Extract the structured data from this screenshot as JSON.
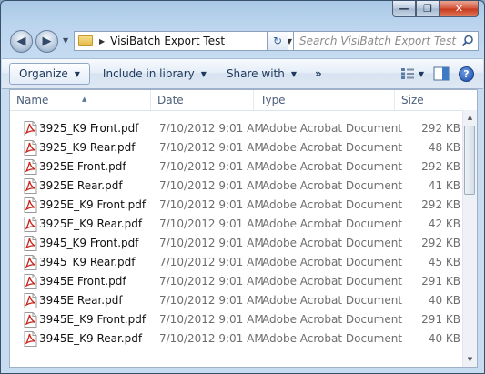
{
  "window": {
    "caption_min": "—",
    "caption_max": "❐",
    "caption_close": "✕"
  },
  "nav": {
    "back_glyph": "◀",
    "forward_glyph": "▶",
    "breadcrumb": "VisiBatch Export Test",
    "search_placeholder": "Search VisiBatch Export Test",
    "refresh_glyph": "↻"
  },
  "toolbar": {
    "organize": "Organize",
    "include_in_library": "Include in library",
    "share_with": "Share with",
    "more": "»"
  },
  "columns": {
    "name": "Name",
    "date": "Date",
    "type": "Type",
    "size": "Size"
  },
  "files": [
    {
      "name": "3925_K9 Front.pdf",
      "date": "7/10/2012 9:01 AM",
      "type": "Adobe Acrobat Document",
      "size": "292 KB"
    },
    {
      "name": "3925_K9 Rear.pdf",
      "date": "7/10/2012 9:01 AM",
      "type": "Adobe Acrobat Document",
      "size": "48 KB"
    },
    {
      "name": "3925E Front.pdf",
      "date": "7/10/2012 9:01 AM",
      "type": "Adobe Acrobat Document",
      "size": "292 KB"
    },
    {
      "name": "3925E Rear.pdf",
      "date": "7/10/2012 9:01 AM",
      "type": "Adobe Acrobat Document",
      "size": "41 KB"
    },
    {
      "name": "3925E_K9 Front.pdf",
      "date": "7/10/2012 9:01 AM",
      "type": "Adobe Acrobat Document",
      "size": "292 KB"
    },
    {
      "name": "3925E_K9 Rear.pdf",
      "date": "7/10/2012 9:01 AM",
      "type": "Adobe Acrobat Document",
      "size": "42 KB"
    },
    {
      "name": "3945_K9 Front.pdf",
      "date": "7/10/2012 9:01 AM",
      "type": "Adobe Acrobat Document",
      "size": "292 KB"
    },
    {
      "name": "3945_K9 Rear.pdf",
      "date": "7/10/2012 9:01 AM",
      "type": "Adobe Acrobat Document",
      "size": "45 KB"
    },
    {
      "name": "3945E Front.pdf",
      "date": "7/10/2012 9:01 AM",
      "type": "Adobe Acrobat Document",
      "size": "291 KB"
    },
    {
      "name": "3945E Rear.pdf",
      "date": "7/10/2012 9:01 AM",
      "type": "Adobe Acrobat Document",
      "size": "40 KB"
    },
    {
      "name": "3945E_K9 Front.pdf",
      "date": "7/10/2012 9:01 AM",
      "type": "Adobe Acrobat Document",
      "size": "291 KB"
    },
    {
      "name": "3945E_K9 Rear.pdf",
      "date": "7/10/2012 9:01 AM",
      "type": "Adobe Acrobat Document",
      "size": "40 KB"
    }
  ],
  "colors": {
    "pdf_red": "#c8241c",
    "link_blue": "#1e395b"
  }
}
